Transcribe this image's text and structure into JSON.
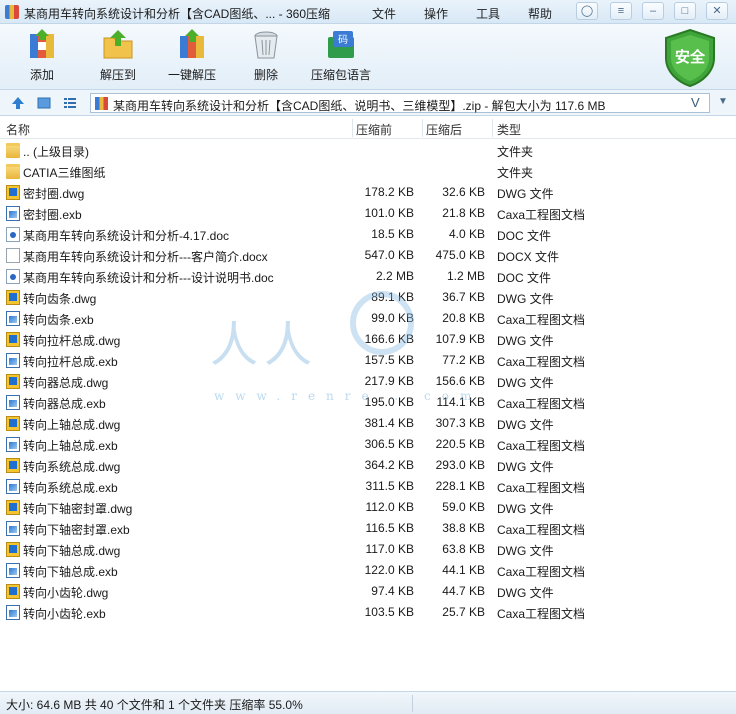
{
  "window": {
    "title": "某商用车转向系统设计和分析【含CAD图纸、... - 360压缩",
    "menus": [
      "文件",
      "操作",
      "工具",
      "帮助"
    ]
  },
  "toolbar": {
    "buttons": [
      {
        "label": "添加",
        "icon": "add-archive-icon"
      },
      {
        "label": "解压到",
        "icon": "extract-to-icon"
      },
      {
        "label": "一键解压",
        "icon": "one-click-extract-icon"
      },
      {
        "label": "删除",
        "icon": "trash-icon"
      },
      {
        "label": "压缩包语言",
        "icon": "archive-language-icon"
      }
    ],
    "security_label": "安全"
  },
  "address": {
    "path": "某商用车转向系统设计和分析【含CAD图纸、说明书、三维模型】.zip - 解包大小为 117.6 MB",
    "v_label": "V"
  },
  "columns": {
    "name": "名称",
    "size": "压缩前",
    "compressed": "压缩后",
    "type": "类型"
  },
  "files": [
    {
      "name": ".. (上级目录)",
      "size": "",
      "compressed": "",
      "type": "文件夹",
      "icon": "folder"
    },
    {
      "name": "CATIA三维图纸",
      "size": "",
      "compressed": "",
      "type": "文件夹",
      "icon": "folder"
    },
    {
      "name": "密封圈.dwg",
      "size": "178.2 KB",
      "compressed": "32.6 KB",
      "type": "DWG 文件",
      "icon": "dwg"
    },
    {
      "name": "密封圈.exb",
      "size": "101.0 KB",
      "compressed": "21.8 KB",
      "type": "Caxa工程图文档",
      "icon": "exb"
    },
    {
      "name": "某商用车转向系统设计和分析-4.17.doc",
      "size": "18.5 KB",
      "compressed": "4.0 KB",
      "type": "DOC 文件",
      "icon": "doc"
    },
    {
      "name": "某商用车转向系统设计和分析---客户简介.docx",
      "size": "547.0 KB",
      "compressed": "475.0 KB",
      "type": "DOCX 文件",
      "icon": "docx"
    },
    {
      "name": "某商用车转向系统设计和分析---设计说明书.doc",
      "size": "2.2 MB",
      "compressed": "1.2 MB",
      "type": "DOC 文件",
      "icon": "doc"
    },
    {
      "name": "转向齿条.dwg",
      "size": "89.1 KB",
      "compressed": "36.7 KB",
      "type": "DWG 文件",
      "icon": "dwg"
    },
    {
      "name": "转向齿条.exb",
      "size": "99.0 KB",
      "compressed": "20.8 KB",
      "type": "Caxa工程图文档",
      "icon": "exb"
    },
    {
      "name": "转向拉杆总成.dwg",
      "size": "166.6 KB",
      "compressed": "107.9 KB",
      "type": "DWG 文件",
      "icon": "dwg"
    },
    {
      "name": "转向拉杆总成.exb",
      "size": "157.5 KB",
      "compressed": "77.2 KB",
      "type": "Caxa工程图文档",
      "icon": "exb"
    },
    {
      "name": "转向器总成.dwg",
      "size": "217.9 KB",
      "compressed": "156.6 KB",
      "type": "DWG 文件",
      "icon": "dwg"
    },
    {
      "name": "转向器总成.exb",
      "size": "195.0 KB",
      "compressed": "114.1 KB",
      "type": "Caxa工程图文档",
      "icon": "exb"
    },
    {
      "name": "转向上轴总成.dwg",
      "size": "381.4 KB",
      "compressed": "307.3 KB",
      "type": "DWG 文件",
      "icon": "dwg"
    },
    {
      "name": "转向上轴总成.exb",
      "size": "306.5 KB",
      "compressed": "220.5 KB",
      "type": "Caxa工程图文档",
      "icon": "exb"
    },
    {
      "name": "转向系统总成.dwg",
      "size": "364.2 KB",
      "compressed": "293.0 KB",
      "type": "DWG 文件",
      "icon": "dwg"
    },
    {
      "name": "转向系统总成.exb",
      "size": "311.5 KB",
      "compressed": "228.1 KB",
      "type": "Caxa工程图文档",
      "icon": "exb"
    },
    {
      "name": "转向下轴密封罩.dwg",
      "size": "112.0 KB",
      "compressed": "59.0 KB",
      "type": "DWG 文件",
      "icon": "dwg"
    },
    {
      "name": "转向下轴密封罩.exb",
      "size": "116.5 KB",
      "compressed": "38.8 KB",
      "type": "Caxa工程图文档",
      "icon": "exb"
    },
    {
      "name": "转向下轴总成.dwg",
      "size": "117.0 KB",
      "compressed": "63.8 KB",
      "type": "DWG 文件",
      "icon": "dwg"
    },
    {
      "name": "转向下轴总成.exb",
      "size": "122.0 KB",
      "compressed": "44.1 KB",
      "type": "Caxa工程图文档",
      "icon": "exb"
    },
    {
      "name": "转向小齿轮.dwg",
      "size": "97.4 KB",
      "compressed": "44.7 KB",
      "type": "DWG 文件",
      "icon": "dwg"
    },
    {
      "name": "转向小齿轮.exb",
      "size": "103.5 KB",
      "compressed": "25.7 KB",
      "type": "Caxa工程图文档",
      "icon": "exb"
    }
  ],
  "watermark": {
    "text": "人人",
    "url": "www.renre...com"
  },
  "status": {
    "text": "大小: 64.6 MB 共 40 个文件和 1 个文件夹 压缩率 55.0%"
  }
}
